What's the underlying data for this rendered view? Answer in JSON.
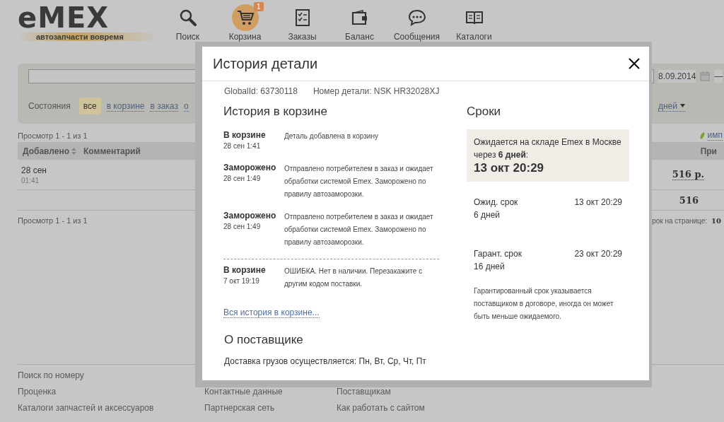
{
  "header": {
    "logo": "eMEX",
    "tagline": "автозапчасти вовремя",
    "nav": [
      {
        "label": "Поиск",
        "kind": "search",
        "selected": false
      },
      {
        "label": "Корзина",
        "kind": "cart",
        "selected": true,
        "badge": "1"
      },
      {
        "label": "Заказы",
        "kind": "checklist",
        "selected": false
      },
      {
        "label": "Баланс",
        "kind": "wallet",
        "selected": false
      },
      {
        "label": "Сообщения",
        "kind": "chat",
        "selected": false
      },
      {
        "label": "Каталоги",
        "kind": "book",
        "selected": false
      }
    ]
  },
  "filter": {
    "date": "8.09.2014",
    "date_separator": "—",
    "states_label": "Состояния",
    "states": [
      {
        "label": "все",
        "selected": true
      },
      {
        "label": "в корзине",
        "selected": false
      },
      {
        "label": "в заказ",
        "selected": false
      },
      {
        "label": "о",
        "selected": false
      }
    ],
    "period": "дней"
  },
  "list": {
    "pager_top": "Просмотр 1 - 1 из 1",
    "import_link": "имп",
    "columns": [
      "Добавлено",
      "Комментарий"
    ],
    "column_3": "При",
    "rows": [
      {
        "date": "28 сен",
        "time": "01:41",
        "price": "516 р."
      }
    ],
    "total": "516",
    "pager_bottom": "Просмотр 1 - 1 из 1",
    "per_page_label": "рок на странице:",
    "per_page": "10"
  },
  "footer": {
    "columns": [
      [
        "Поиск по номеру",
        "Проценка",
        "Каталоги запчастей и аксессуаров"
      ],
      [
        "Контактные данные",
        "Партнерская сеть"
      ],
      [
        "Поставщикам",
        "Как работать с сайтом"
      ]
    ]
  },
  "modal": {
    "title": "История детали",
    "global_id": "GlobalId: 63730118",
    "part_number": "Номер детали: NSK HR32028XJ",
    "history_title": "История в корзине",
    "history": [
      {
        "status": "В корзине",
        "date": "28 сен 1:41",
        "text": "Деталь добавлена в корзину",
        "divider_above": false
      },
      {
        "status": "Заморожено",
        "date": "28 сен 1:49",
        "text": "Отправлено потребителем в заказ и ожидает обработки системой Emex. Заморожено по правилу автозаморозки.",
        "divider_above": false
      },
      {
        "status": "Заморожено",
        "date": "28 сен 1:49",
        "text": "Отправлено потребителем в заказ и ожидает обработки системой Emex. Заморожено по правилу автозаморозки.",
        "divider_above": false
      },
      {
        "status": "В корзине",
        "date": "7 окт 19:19",
        "text": "ОШИБКА. Нет в наличии. Перезакажите с другим кодом поставки.",
        "divider_above": true
      }
    ],
    "history_link": "Вся история в корзине...",
    "terms_title": "Сроки",
    "expected_text": "Ожидается на складе Emex в Москве через **6 дней**:",
    "expected_date": "13 окт 20:29",
    "terms": [
      {
        "label": "Ожид. срок",
        "days": "6 дней",
        "date": "13 окт 20:29"
      },
      {
        "label": "Гарант. срок",
        "days": "16 дней",
        "date": "23 окт 20:29"
      }
    ],
    "terms_note": "Гарантированный срок указывается поставщиком в договоре, иногда он может быть меньше ожидаемого.",
    "supplier_title": "О поставщике",
    "supplier_text": "Доставка грузов осуществляется: Пн, Вт, Ср, Чт, Пт"
  }
}
